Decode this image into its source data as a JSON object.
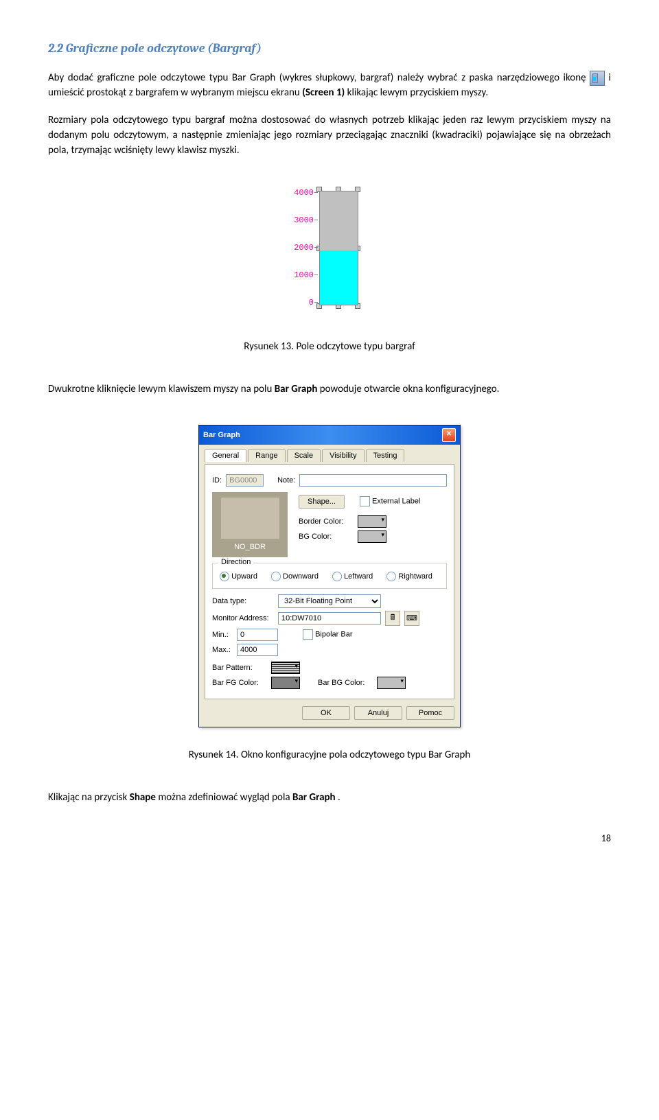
{
  "heading": "2.2 Graficzne pole odczytowe (Bargraf)",
  "p1a": "Aby dodać graficzne pole odczytowe typu Bar Graph (wykres słupkowy, bargraf) należy wybrać z paska narzędziowego ikonę ",
  "p1b": " i umieścić prostokąt z bargrafem w wybranym miejscu ekranu ",
  "screen_ref1": "(Screen 1)",
  "p1c": " klikając lewym przyciskiem myszy.",
  "p2": "Rozmiary pola odczytowego typu bargraf można dostosować do własnych potrzeb klikając jeden raz lewym przyciskiem myszy na dodanym polu odczytowym, a następnie zmieniając jego rozmiary przeciągając znaczniki (kwadraciki) pojawiające się na obrzeżach pola, trzymając wciśnięty lewy klawisz myszki.",
  "bargraf": {
    "ticks": [
      "4000",
      "3000",
      "2000",
      "1000",
      "0"
    ],
    "fill_percent": 48
  },
  "fig13": "Rysunek 13. Pole odczytowe typu bargraf",
  "p3a": "Dwukrotne kliknięcie lewym klawiszem myszy na polu ",
  "p3b": "Bar Graph",
  "p3c": " powoduje otwarcie okna konfiguracyjnego.",
  "dialog": {
    "title": "Bar Graph",
    "tabs": [
      "General",
      "Range",
      "Scale",
      "Visibility",
      "Testing"
    ],
    "id_label": "ID:",
    "id_value": "BG0000",
    "note_label": "Note:",
    "note_value": "",
    "shape_btn": "Shape...",
    "external_label": "External Label",
    "border_color_label": "Border Color:",
    "bg_color_label": "BG Color:",
    "shape_name": "NO_BDR",
    "direction_group": "Direction",
    "dir_up": "Upward",
    "dir_down": "Downward",
    "dir_left": "Leftward",
    "dir_right": "Rightward",
    "data_type_label": "Data type:",
    "data_type_value": "32-Bit Floating Point",
    "monitor_label": "Monitor Address:",
    "monitor_value": "10:DW7010",
    "min_label": "Min.:",
    "min_value": "0",
    "bipolar_label": "Bipolar Bar",
    "max_label": "Max.:",
    "max_value": "4000",
    "bar_pattern_label": "Bar Pattern:",
    "bar_fg_label": "Bar FG Color:",
    "bar_bg_label": "Bar BG Color:",
    "ok": "OK",
    "cancel": "Anuluj",
    "help": "Pomoc"
  },
  "fig14": "Rysunek 14. Okno konfiguracyjne pola odczytowego typu Bar Graph",
  "p4a": "Klikając na przycisk ",
  "p4b": "Shape",
  "p4c": " można zdefiniować wygląd pola ",
  "p4d": "Bar Graph",
  "p4e": ".",
  "page_number": "18"
}
